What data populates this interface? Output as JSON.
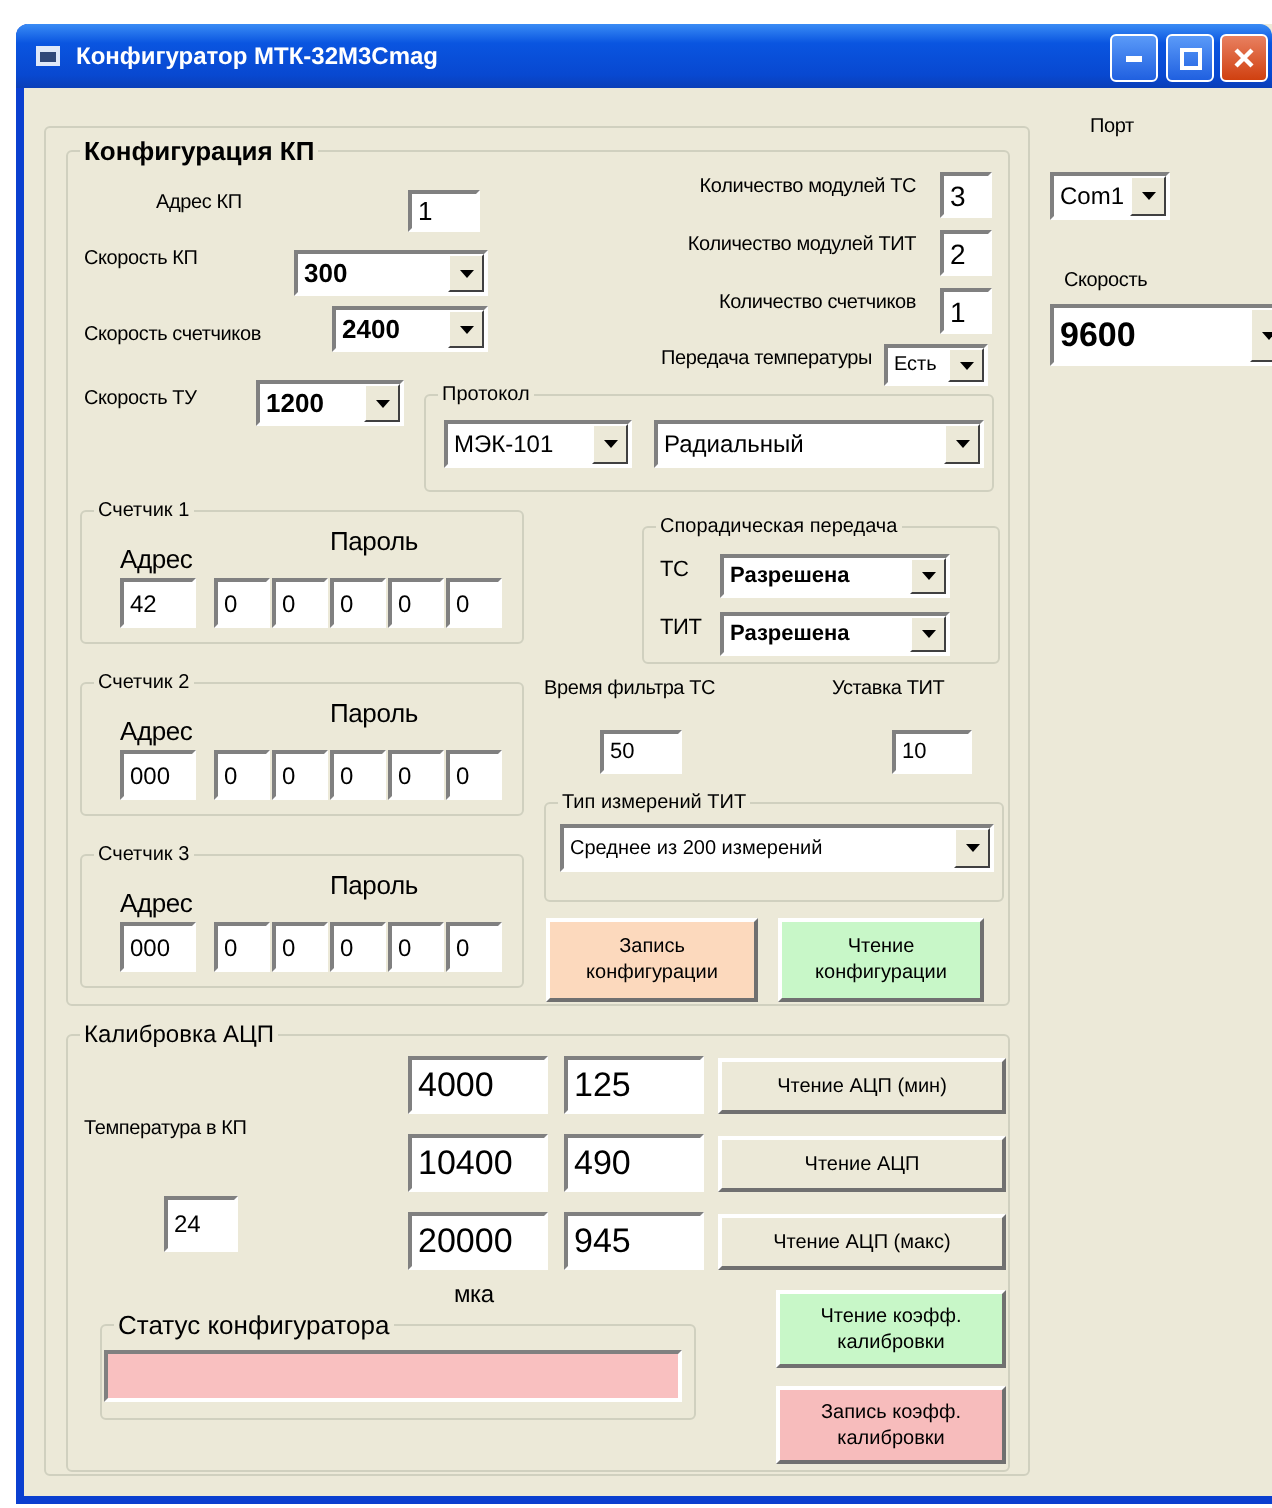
{
  "window": {
    "title": "Конфигуратор МТК-32М3Cmag"
  },
  "config": {
    "title": "Конфигурация КП",
    "address": {
      "label": "Адрес КП",
      "value": "1"
    },
    "speeds": [
      {
        "label": "Скорость КП",
        "value": "300"
      },
      {
        "label": "Скорость счетчиков",
        "value": "2400"
      },
      {
        "label": "Скорость ТУ",
        "value": "1200"
      }
    ],
    "counts": [
      {
        "label": "Количество модулей ТС",
        "value": "3"
      },
      {
        "label": "Количество модулей ТИТ",
        "value": "2"
      },
      {
        "label": "Количество счетчиков",
        "value": "1"
      }
    ],
    "temperature_transfer": {
      "label": "Передача температуры",
      "value": "Есть"
    },
    "protocol": {
      "title": "Протокол",
      "values": [
        "МЭК-101",
        "Радиальный"
      ]
    },
    "meters": [
      {
        "title": "Счетчик 1",
        "address_label": "Адрес",
        "password_label": "Пароль",
        "address": "42",
        "password": [
          "0",
          "0",
          "0",
          "0",
          "0"
        ]
      },
      {
        "title": "Счетчик 2",
        "address_label": "Адрес",
        "password_label": "Пароль",
        "address": "000",
        "password": [
          "0",
          "0",
          "0",
          "0",
          "0"
        ]
      },
      {
        "title": "Счетчик 3",
        "address_label": "Адрес",
        "password_label": "Пароль",
        "address": "000",
        "password": [
          "0",
          "0",
          "0",
          "0",
          "0"
        ]
      }
    ],
    "sporadic": {
      "title": "Спорадическая передача",
      "rows": [
        {
          "label": "ТС",
          "value": "Разрешена"
        },
        {
          "label": "ТИТ",
          "value": "Разрешена"
        }
      ]
    },
    "filter_time": {
      "label": "Время фильтра ТС",
      "value": "50"
    },
    "tit_setpoint": {
      "label": "Уставка ТИТ",
      "value": "10"
    },
    "measure_type": {
      "title": "Тип измерений ТИТ",
      "value": "Среднее из 200 измерений"
    },
    "buttons": [
      {
        "label": "Запись конфигурации",
        "color": "#fcd9bd"
      },
      {
        "label": "Чтение конфигурации",
        "color": "#c8f7c8"
      }
    ]
  },
  "calibration": {
    "title": "Калибровка АЦП",
    "temperature": {
      "label": "Температура в КП",
      "value": "24"
    },
    "rows": [
      {
        "current": "4000",
        "adc": "125",
        "button": "Чтение АЦП (мин)"
      },
      {
        "current": "10400",
        "adc": "490",
        "button": "Чтение АЦП"
      },
      {
        "current": "20000",
        "adc": "945",
        "button": "Чтение АЦП (макс)"
      }
    ],
    "unit": "мка",
    "status": {
      "title": "Статус конфигуратора"
    },
    "buttons": [
      {
        "label": "Чтение коэфф. калибровки",
        "color": "#c8f7c8"
      },
      {
        "label": "Запись коэфф. калибровки",
        "color": "#f7bcbc"
      }
    ]
  },
  "port": {
    "label": "Порт",
    "value": "Com1"
  },
  "speed": {
    "label": "Скорость",
    "value": "9600"
  }
}
